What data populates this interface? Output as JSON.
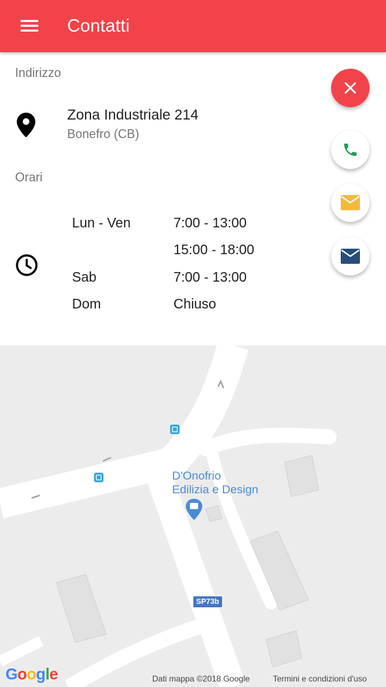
{
  "appbar": {
    "title": "Contatti",
    "color": "#f2434a",
    "menu_icon": "hamburger-menu-icon"
  },
  "address": {
    "label": "Indirizzo",
    "street": "Zona Industriale 214",
    "city": "Bonefro (CB)",
    "icon": "location-pin-icon"
  },
  "hours": {
    "label": "Orari",
    "icon": "clock-icon",
    "rows": [
      {
        "day": "Lun - Ven",
        "time": "7:00 - 13:00"
      },
      {
        "day": "",
        "time": "15:00 - 18:00"
      },
      {
        "day": "Sab",
        "time": "7:00 - 13:00"
      },
      {
        "day": "Dom",
        "time": "Chiuso"
      }
    ]
  },
  "fabs": {
    "close_icon": "close-icon",
    "phone_icon": "phone-icon",
    "email_icon": "email-icon",
    "message_icon": "message-icon"
  },
  "map": {
    "place_line1": "D'Onofrio",
    "place_line2": "Edilizia e Design",
    "road_shield": "SP73b",
    "logo": "Google",
    "data_credit": "Dati mappa ©2018 Google",
    "terms": "Termini e condizioni d'uso"
  }
}
